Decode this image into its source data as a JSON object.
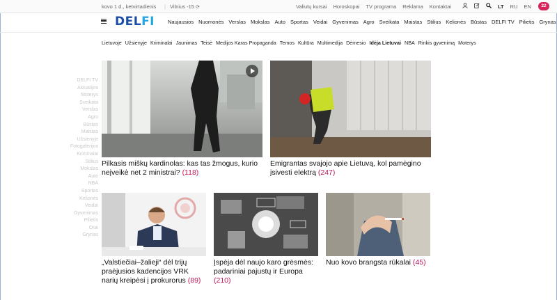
{
  "topbar": {
    "date": "kovo 1 d., ketvirtadienis",
    "weather": "Vilnius -15",
    "links": [
      "Valiutų kursai",
      "Horoskopai",
      "TV programa",
      "Reklama",
      "Kontaktai"
    ],
    "icons": [
      "user-icon",
      "edit-icon",
      "search-icon"
    ],
    "languages": [
      "LT",
      "RU",
      "EN"
    ],
    "active_language": "LT",
    "notification_count": "22"
  },
  "header": {
    "logo_text": "DELFI",
    "nav": [
      "Naujausios",
      "Nuomonės",
      "Verslas",
      "Mokslas",
      "Auto",
      "Sportas",
      "Veidai",
      "Gyvenimas",
      "Agro",
      "Sveikata",
      "Maistas",
      "Stilius",
      "Kelionės",
      "Būstas",
      "DELFI TV",
      "Pilietis",
      "Grynas"
    ]
  },
  "subnav": {
    "items": [
      "Lietuvoje",
      "Užsienyje",
      "Kriminalai",
      "Jaunimas",
      "Teisė",
      "Medijos Karas Propaganda",
      "Temos",
      "Kultūra",
      "Multimedija",
      "Dėmesio",
      "Idėja Lietuvai",
      "NBA",
      "Rinkis gyvenimą",
      "Moterys"
    ],
    "active": "Idėja Lietuvai"
  },
  "left_list": [
    "DELFI TV",
    "Aktualijos",
    "Moterys",
    "Sveikata",
    "Verslas",
    "Agro",
    "Būstas",
    "Maistas",
    "Užsienyje",
    "Fotogalerijos",
    "Kriminalai",
    "Stilius",
    "Mokslas",
    "Auto",
    "NBA",
    "Sportas",
    "Kelionės",
    "Veidai",
    "Gyvenimas",
    "Pilietis",
    "Orai",
    "Grynas"
  ],
  "articles": [
    {
      "title": "Pilkasis miškų kardinolas: kas tas žmogus, kurio neįveikė net 2 ministrai?",
      "count": "(118)",
      "image": "silhouette-walking-photo",
      "video": true
    },
    {
      "title": "Emigrantas svajojo apie Lietuvą, kol pamėgino įsivesti elektrą",
      "count": "(247)",
      "image": "construction-worker-photo",
      "video": false
    },
    {
      "title": "„Valstiečiai–žalieji“ dėl trijų praėjusios kadencijos VRK narių kreipėsi į prokurorus",
      "count": "(89)",
      "image": "press-conference-photo",
      "video": false
    },
    {
      "title": "Įspėja dėl naujo karo grėsmės: padariniai pajustų ir Europa",
      "count": "(210)",
      "image": "aerial-strike-photo",
      "video": false
    },
    {
      "title": "Nuo kovo brangsta rūkalai",
      "count": "(45)",
      "image": "smoking-hands-photo",
      "video": false
    }
  ],
  "colors": {
    "brand_dark": "#1a4ea7",
    "brand_light": "#26a5e4",
    "comment_count": "#c2185b",
    "badge": "#d6245a"
  }
}
